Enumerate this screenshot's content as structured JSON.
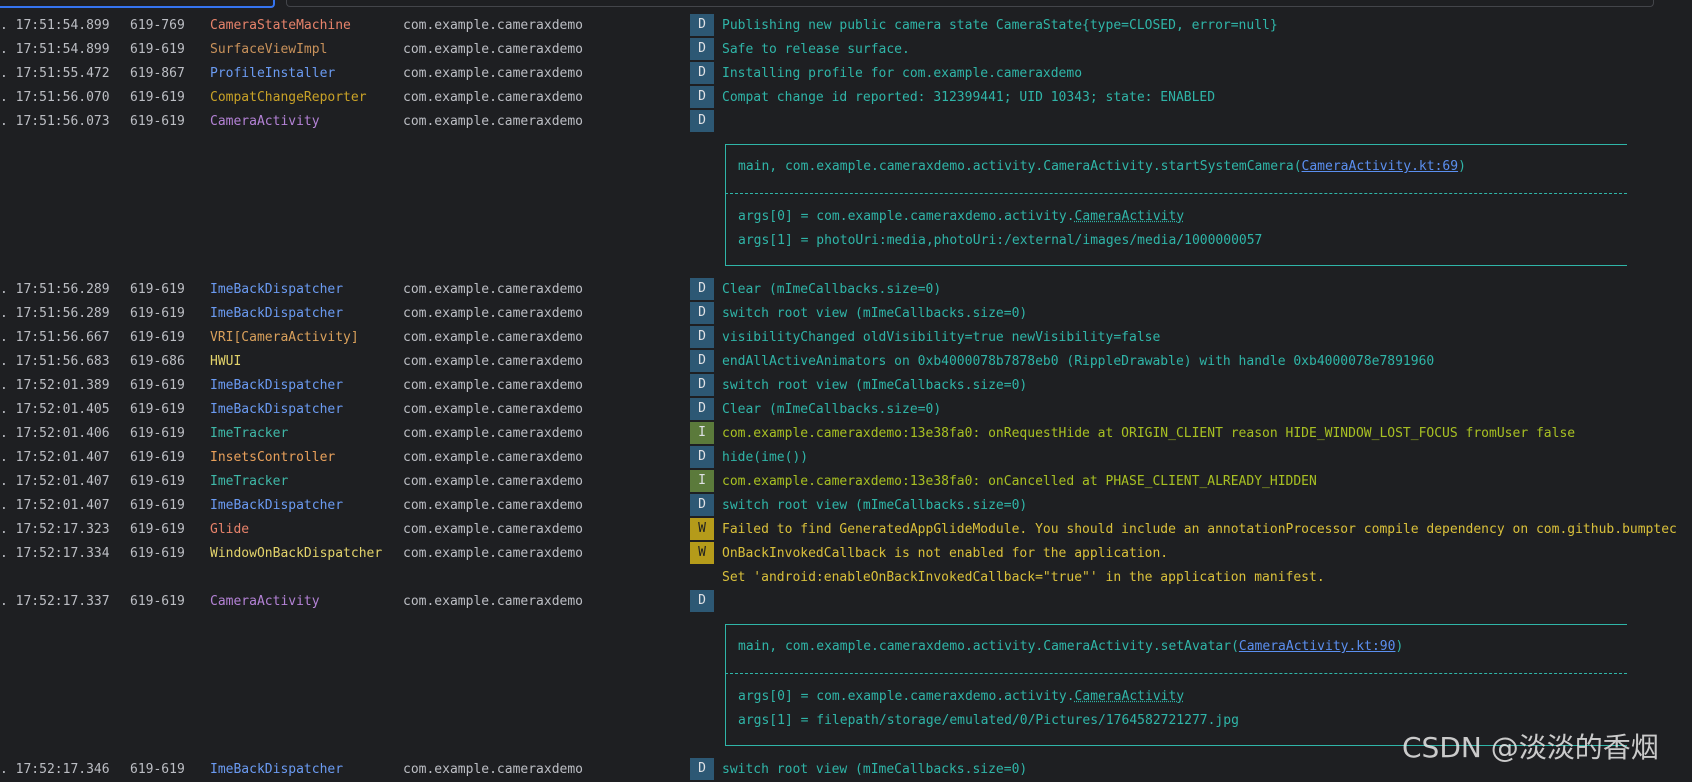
{
  "rows": [
    {
      "time": ". 17:51:54.899",
      "pid": "619-769",
      "tag": "CameraStateMachine",
      "tag_color": "#e8836b",
      "pkg": "com.example.cameraxdemo",
      "level": "D",
      "msg": "Publishing new public camera state CameraState{type=CLOSED, error=null}"
    },
    {
      "time": ". 17:51:54.899",
      "pid": "619-619",
      "tag": "SurfaceViewImpl",
      "tag_color": "#c9925b",
      "pkg": "com.example.cameraxdemo",
      "level": "D",
      "msg": "Safe to release surface."
    },
    {
      "time": ". 17:51:55.472",
      "pid": "619-867",
      "tag": "ProfileInstaller",
      "tag_color": "#6b9bf2",
      "pkg": "com.example.cameraxdemo",
      "level": "D",
      "msg": "Installing profile for com.example.cameraxdemo"
    },
    {
      "time": ". 17:51:56.070",
      "pid": "619-619",
      "tag": "CompatChangeReporter",
      "tag_color": "#c9a227",
      "pkg": "com.example.cameraxdemo",
      "level": "D",
      "msg": "Compat change id reported: 312399441; UID 10343; state: ENABLED"
    },
    {
      "time": ". 17:51:56.073",
      "pid": "619-619",
      "tag": "CameraActivity",
      "tag_color": "#b482d6",
      "pkg": "com.example.cameraxdemo",
      "level": "D",
      "msg": ""
    },
    {
      "time": ". 17:51:56.289",
      "pid": "619-619",
      "tag": "ImeBackDispatcher",
      "tag_color": "#6b9bf2",
      "pkg": "com.example.cameraxdemo",
      "level": "D",
      "msg": "Clear (mImeCallbacks.size=0)"
    },
    {
      "time": ". 17:51:56.289",
      "pid": "619-619",
      "tag": "ImeBackDispatcher",
      "tag_color": "#6b9bf2",
      "pkg": "com.example.cameraxdemo",
      "level": "D",
      "msg": "switch root view (mImeCallbacks.size=0)"
    },
    {
      "time": ". 17:51:56.667",
      "pid": "619-619",
      "tag": "VRI[CameraActivity]",
      "tag_color": "#d9a05b",
      "pkg": "com.example.cameraxdemo",
      "level": "D",
      "msg": "visibilityChanged oldVisibility=true newVisibility=false"
    },
    {
      "time": ". 17:51:56.683",
      "pid": "619-686",
      "tag": "HWUI",
      "tag_color": "#e3d36b",
      "pkg": "com.example.cameraxdemo",
      "level": "D",
      "msg": "endAllActiveAnimators on 0xb4000078b7878eb0 (RippleDrawable) with handle 0xb4000078e7891960"
    },
    {
      "time": ". 17:52:01.389",
      "pid": "619-619",
      "tag": "ImeBackDispatcher",
      "tag_color": "#6b9bf2",
      "pkg": "com.example.cameraxdemo",
      "level": "D",
      "msg": "switch root view (mImeCallbacks.size=0)"
    },
    {
      "time": ". 17:52:01.405",
      "pid": "619-619",
      "tag": "ImeBackDispatcher",
      "tag_color": "#6b9bf2",
      "pkg": "com.example.cameraxdemo",
      "level": "D",
      "msg": "Clear (mImeCallbacks.size=0)"
    },
    {
      "time": ". 17:52:01.406",
      "pid": "619-619",
      "tag": "ImeTracker",
      "tag_color": "#3fb8a8",
      "pkg": "com.example.cameraxdemo",
      "level": "I",
      "msg": "com.example.cameraxdemo:13e38fa0: onRequestHide at ORIGIN_CLIENT reason HIDE_WINDOW_LOST_FOCUS fromUser false"
    },
    {
      "time": ". 17:52:01.407",
      "pid": "619-619",
      "tag": "InsetsController",
      "tag_color": "#e8a05b",
      "pkg": "com.example.cameraxdemo",
      "level": "D",
      "msg": "hide(ime())"
    },
    {
      "time": ". 17:52:01.407",
      "pid": "619-619",
      "tag": "ImeTracker",
      "tag_color": "#3fb8a8",
      "pkg": "com.example.cameraxdemo",
      "level": "I",
      "msg": "com.example.cameraxdemo:13e38fa0: onCancelled at PHASE_CLIENT_ALREADY_HIDDEN"
    },
    {
      "time": ". 17:52:01.407",
      "pid": "619-619",
      "tag": "ImeBackDispatcher",
      "tag_color": "#6b9bf2",
      "pkg": "com.example.cameraxdemo",
      "level": "D",
      "msg": "switch root view (mImeCallbacks.size=0)"
    },
    {
      "time": ". 17:52:17.323",
      "pid": "619-619",
      "tag": "Glide",
      "tag_color": "#e8836b",
      "pkg": "com.example.cameraxdemo",
      "level": "W",
      "msg": "Failed to find GeneratedAppGlideModule. You should include an annotationProcessor compile dependency on com.github.bumptec"
    },
    {
      "time": ". 17:52:17.334",
      "pid": "619-619",
      "tag": "WindowOnBackDispatcher",
      "tag_color": "#e3d36b",
      "pkg": "com.example.cameraxdemo",
      "level": "W",
      "msg": "OnBackInvokedCallback is not enabled for the application."
    },
    {
      "time": "",
      "pid": "",
      "tag": "",
      "tag_color": "#e3d36b",
      "pkg": "",
      "level": "",
      "msg": "Set 'android:enableOnBackInvokedCallback=\"true\"' in the application manifest."
    },
    {
      "time": ". 17:52:17.337",
      "pid": "619-619",
      "tag": "CameraActivity",
      "tag_color": "#b482d6",
      "pkg": "com.example.cameraxdemo",
      "level": "D",
      "msg": ""
    },
    {
      "time": ". 17:52:17.346",
      "pid": "619-619",
      "tag": "ImeBackDispatcher",
      "tag_color": "#6b9bf2",
      "pkg": "com.example.cameraxdemo",
      "level": "D",
      "msg": "switch root view (mImeCallbacks.size=0)"
    }
  ],
  "box1": {
    "main_prefix": "main, com.example.cameraxdemo.activity.CameraActivity.startSystemCamera(",
    "main_link": "CameraActivity.kt:69",
    "main_suffix": ")",
    "arg0_prefix": "args[0] = com.example.cameraxdemo.activity.",
    "arg0_class": "CameraActivity",
    "arg1": "args[1] = photoUri:media,photoUri:/external/images/media/1000000057"
  },
  "box2": {
    "main_prefix": "main, com.example.cameraxdemo.activity.CameraActivity.setAvatar(",
    "main_link": "CameraActivity.kt:90",
    "main_suffix": ")",
    "arg0_prefix": "args[0] = com.example.cameraxdemo.activity.",
    "arg0_class": "CameraActivity",
    "arg1": "args[1] = filepath/storage/emulated/0/Pictures/1764582721277.jpg"
  },
  "watermark": "CSDN @淡淡的香烟"
}
